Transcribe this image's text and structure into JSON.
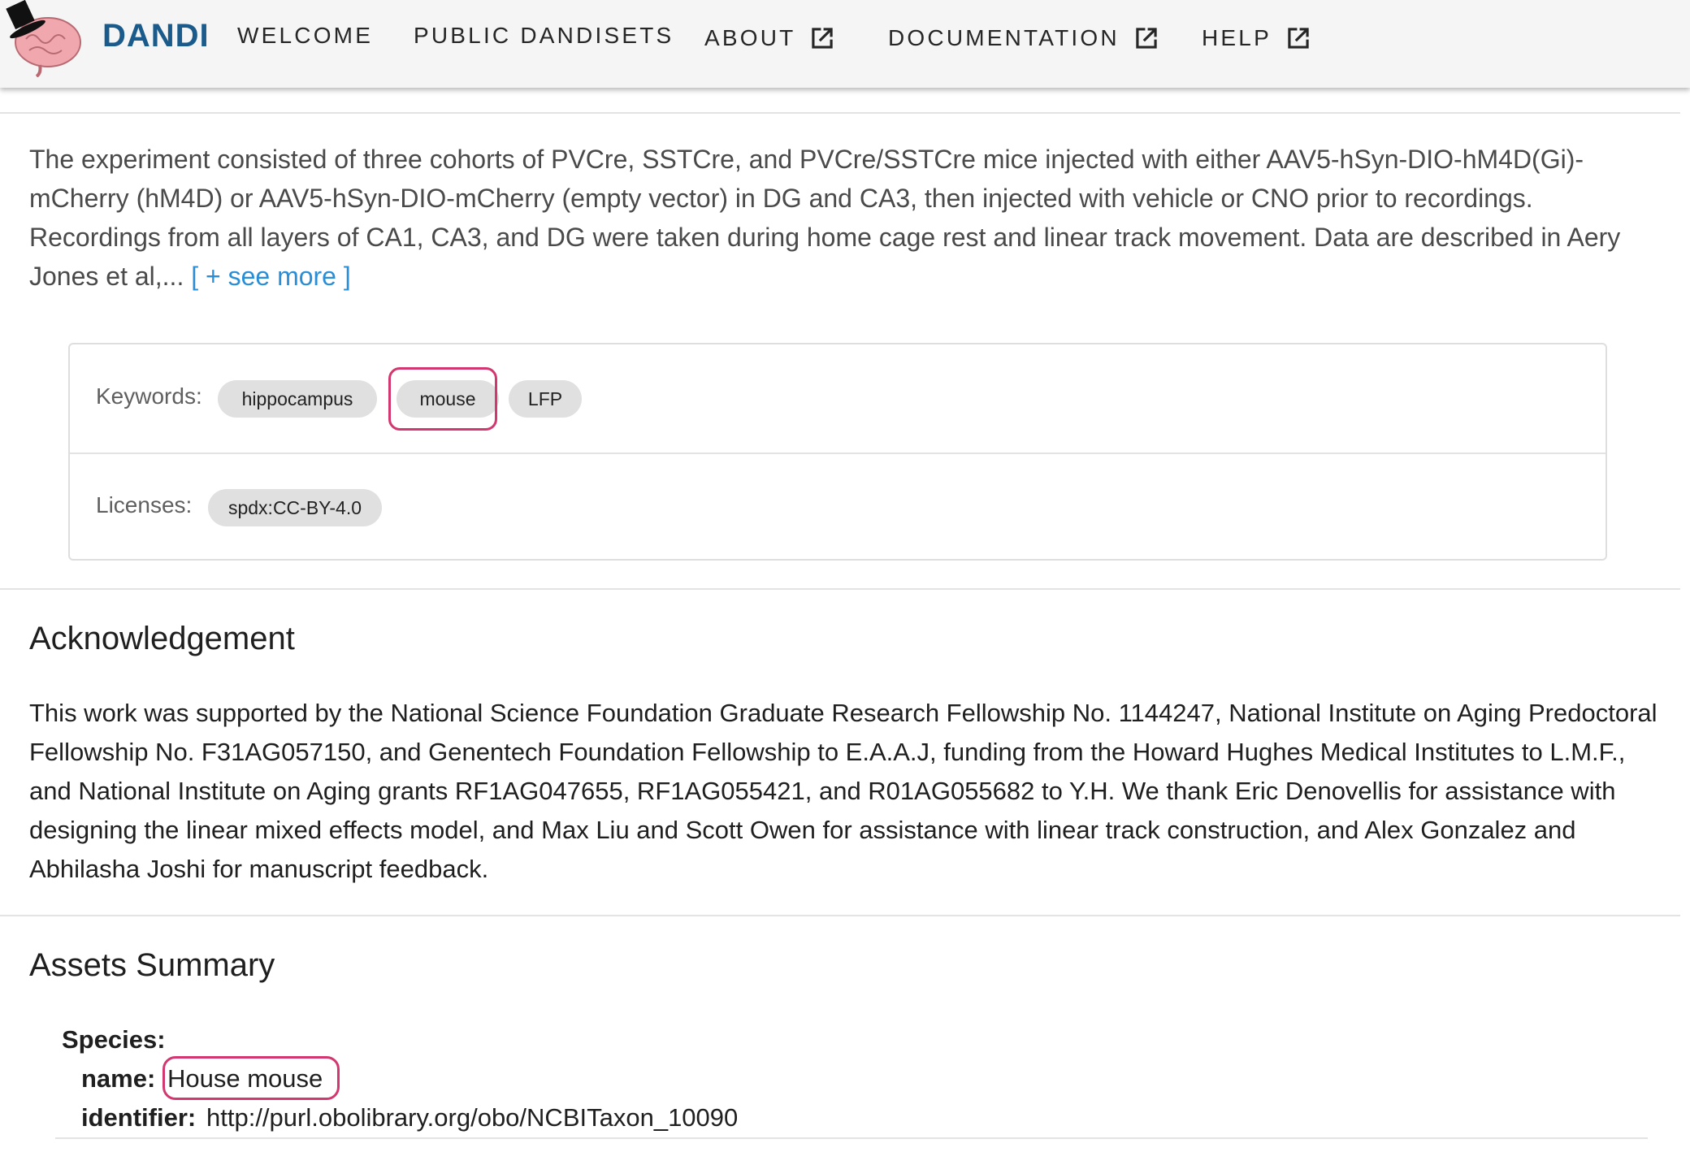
{
  "header": {
    "brand": "DANDI",
    "nav": [
      {
        "label": "WELCOME",
        "external": false
      },
      {
        "label": "PUBLIC DANDISETS",
        "external": false
      },
      {
        "label": "ABOUT",
        "external": true
      },
      {
        "label": "DOCUMENTATION",
        "external": true
      },
      {
        "label": "HELP",
        "external": true
      }
    ],
    "external_icon": "open-in-new-icon"
  },
  "description": {
    "text": "The experiment consisted of three cohorts of PVCre, SSTCre, and PVCre/SSTCre mice injected with either AAV5-hSyn-DIO-hM4D(Gi)-mCherry (hM4D) or AAV5-hSyn-DIO-mCherry (empty vector) in DG and CA3, then injected with vehicle or CNO prior to recordings. Recordings from all layers of CA1, CA3, and DG were taken during home cage rest and linear track movement. Data are described in Aery Jones et al,... ",
    "see_more": "[ + see more ]"
  },
  "metadata_card": {
    "keywords_label": "Keywords:",
    "keywords": [
      "hippocampus",
      "mouse",
      "LFP"
    ],
    "licenses_label": "Licenses:",
    "licenses": [
      "spdx:CC-BY-4.0"
    ]
  },
  "acknowledgement": {
    "title": "Acknowledgement",
    "text": "This work was supported by the National Science Foundation Graduate Research Fellowship No. 1144247, National Institute on Aging Predoctoral Fellowship No. F31AG057150, and Genentech Foundation Fellowship to E.A.A.J, funding from the Howard Hughes Medical Institutes to L.M.F., and National Institute on Aging grants RF1AG047655, RF1AG055421, and R01AG055682 to Y.H. We thank Eric Denovellis for assistance with designing the linear mixed effects model, and Max Liu and Scott Owen for assistance with linear track construction, and Alex Gonzalez and Abhilasha Joshi for manuscript feedback."
  },
  "assets_summary": {
    "title": "Assets Summary",
    "species_label": "Species:",
    "name_label": "name:",
    "name_value": "House mouse",
    "identifier_label": "identifier:",
    "identifier_value": "http://purl.obolibrary.org/obo/NCBITaxon_10090"
  },
  "colors": {
    "brand": "#1a5b8b",
    "link": "#2a8ed6",
    "highlight": "#d2386f",
    "chip": "#e0e0e0"
  }
}
